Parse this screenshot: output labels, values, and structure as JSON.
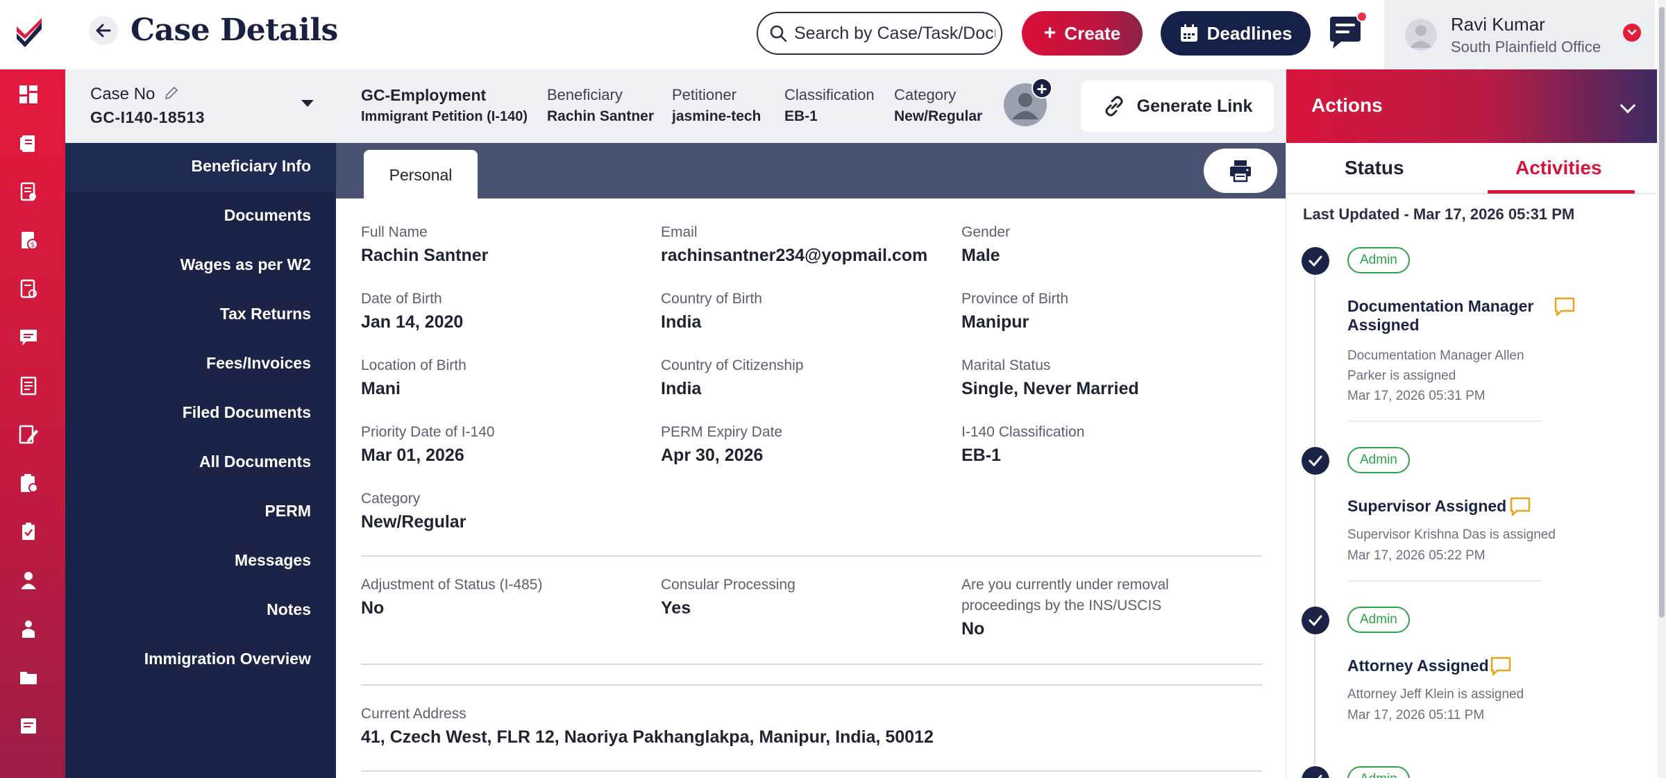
{
  "header": {
    "title": "Case Details",
    "search_placeholder": "Search by Case/Task/Document",
    "create_label": "Create",
    "deadlines_label": "Deadlines",
    "user_name": "Ravi Kumar",
    "user_office": "South Plainfield Office"
  },
  "rail_icons": [
    "dashboard-icon",
    "cases-icon",
    "documents-icon",
    "invoices-icon",
    "forms-icon",
    "messages-icon",
    "notes-icon",
    "edit-docs-icon",
    "clipboard-icon",
    "tasks-icon",
    "person-icon",
    "people-icon",
    "folder-icon",
    "reports-icon"
  ],
  "case": {
    "case_no_label": "Case No",
    "case_no_value": "GC-I140-18513",
    "case_type_title": "GC-Employment",
    "case_type_value": "Immigrant Petition (I-140)",
    "beneficiary_label": "Beneficiary",
    "beneficiary_value": "Rachin Santner",
    "petitioner_label": "Petitioner",
    "petitioner_value": "jasmine-tech",
    "classification_label": "Classification",
    "classification_value": "EB-1",
    "category_label": "Category",
    "category_value": "New/Regular",
    "generate_link_label": "Generate Link"
  },
  "sidenav": {
    "items": [
      "Beneficiary Info",
      "Documents",
      "Wages as per W2",
      "Tax Returns",
      "Fees/Invoices",
      "Filed Documents",
      "All Documents",
      "PERM",
      "Messages",
      "Notes",
      "Immigration Overview"
    ]
  },
  "tabs": {
    "personal": "Personal"
  },
  "personal": {
    "full_name_label": "Full Name",
    "full_name": "Rachin Santner",
    "email_label": "Email",
    "email": "rachinsantner234@yopmail.com",
    "gender_label": "Gender",
    "gender": "Male",
    "dob_label": "Date of Birth",
    "dob": "Jan 14, 2020",
    "country_birth_label": "Country of Birth",
    "country_birth": "India",
    "province_birth_label": "Province of Birth",
    "province_birth": "Manipur",
    "location_birth_label": "Location of Birth",
    "location_birth": "Mani",
    "citizenship_label": "Country of Citizenship",
    "citizenship": "India",
    "marital_label": "Marital Status",
    "marital": "Single, Never Married",
    "priority_label": "Priority Date of I-140",
    "priority": "Mar 01, 2026",
    "perm_expiry_label": "PERM Expiry Date",
    "perm_expiry": "Apr 30, 2026",
    "i140_class_label": "I-140 Classification",
    "i140_class": "EB-1",
    "category_label": "Category",
    "category": "New/Regular",
    "aos_label": "Adjustment of Status (I-485)",
    "aos": "No",
    "consular_label": "Consular Processing",
    "consular": "Yes",
    "removal_label": "Are you currently under removal proceedings by the INS/USCIS",
    "removal": "No",
    "address_label": "Current Address",
    "address": "41, Czech West, FLR 12, Naoriya Pakhanglakpa, Manipur, India, 50012"
  },
  "actions": {
    "title": "Actions",
    "tab_status": "Status",
    "tab_activities": "Activities",
    "last_updated": "Last Updated - Mar 17, 2026 05:31 PM",
    "activities": [
      {
        "badge": "Admin",
        "title": "Documentation Manager Assigned",
        "desc": "Documentation Manager Allen Parker is assigned",
        "date": "Mar 17, 2026 05:31 PM"
      },
      {
        "badge": "Admin",
        "title": "Supervisor Assigned",
        "desc": "Supervisor Krishna Das is assigned",
        "date": "Mar 17, 2026 05:22 PM"
      },
      {
        "badge": "Admin",
        "title": "Attorney Assigned",
        "desc": "Attorney Jeff Klein is assigned",
        "date": "Mar 17, 2026 05:11 PM"
      },
      {
        "badge": "Admin"
      }
    ]
  },
  "colors": {
    "brand_red": "#d8143c",
    "navy": "#1b2347",
    "badge_green": "#2fa24a"
  }
}
